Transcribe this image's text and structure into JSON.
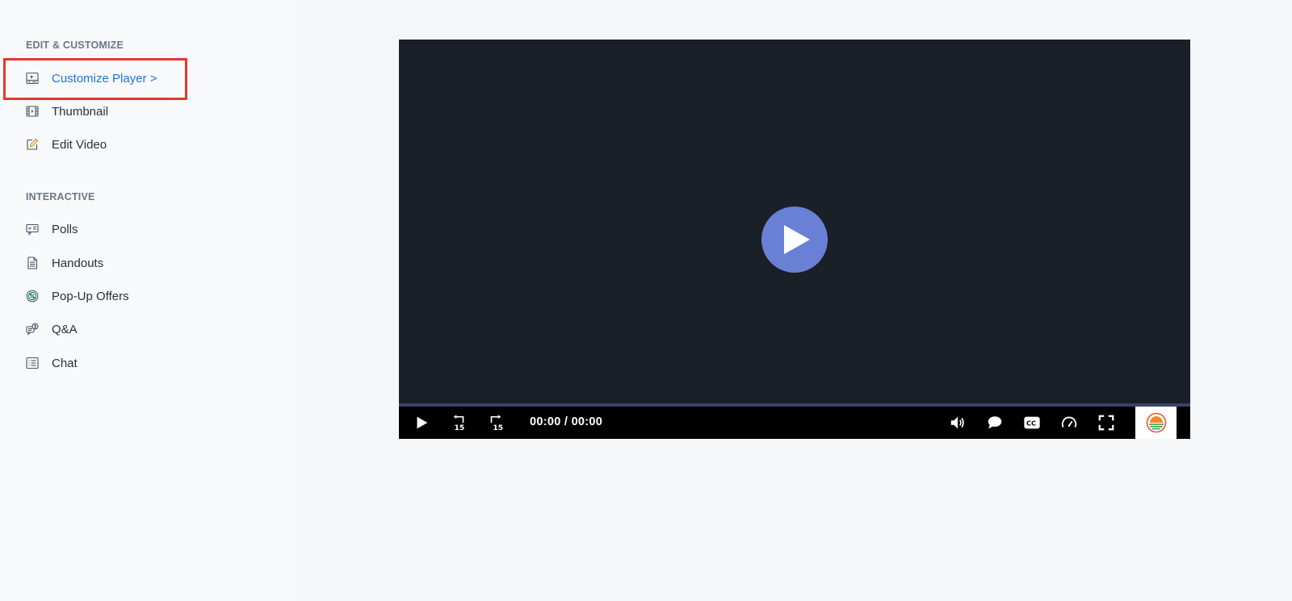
{
  "sidebar": {
    "sections": [
      {
        "title": "EDIT & CUSTOMIZE",
        "items": [
          {
            "label": "Customize Player >",
            "icon": "customize-player-icon",
            "active": true
          },
          {
            "label": "Thumbnail",
            "icon": "film-icon"
          },
          {
            "label": "Edit Video",
            "icon": "edit-pencil-icon"
          }
        ]
      },
      {
        "title": "INTERACTIVE",
        "items": [
          {
            "label": "Polls",
            "icon": "poll-icon"
          },
          {
            "label": "Handouts",
            "icon": "document-icon"
          },
          {
            "label": "Pop-Up Offers",
            "icon": "percent-offer-icon"
          },
          {
            "label": "Q&A",
            "icon": "question-chat-icon"
          },
          {
            "label": "Chat",
            "icon": "chat-list-icon"
          }
        ]
      }
    ]
  },
  "player": {
    "time_display": "00:00 / 00:00",
    "big_play_icon": "play-icon",
    "controls": [
      "play-icon",
      "rewind-15-icon",
      "forward-15-icon",
      "volume-icon",
      "comment-icon",
      "cc-icon",
      "speed-icon",
      "fullscreen-icon"
    ],
    "progress": 0,
    "colors": {
      "accent": "#6a80d4",
      "video_bg": "#1b1f27",
      "progress_track": "#3a4469",
      "active_link": "#1f74d6",
      "highlight": "#e23b2e"
    }
  }
}
